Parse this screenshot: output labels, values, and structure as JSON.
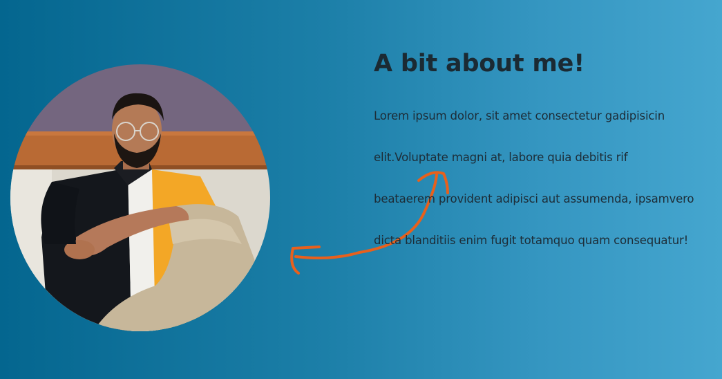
{
  "about": {
    "heading": "A bit about me!",
    "paragraph_lines": [
      "Lorem ipsum dolor, sit amet consectetur gadipisicin",
      "elit.Voluptate magni at, labore quia debitis rif",
      "beataerem provident adipisci aut assumenda, ipsamvero",
      "dicta blanditiis enim fugit totamquo quam consequatur!"
    ]
  },
  "profile_photo": {
    "subject": "man with glasses and beard sitting, wearing black, white and yellow shirt"
  },
  "decoration": {
    "arrow_icon": "curved-arrow-icon",
    "arrow_color": "#e8601c"
  },
  "colors": {
    "background_left": "#04668f",
    "background_right": "#45a6cf",
    "text": "#1b2a33"
  }
}
